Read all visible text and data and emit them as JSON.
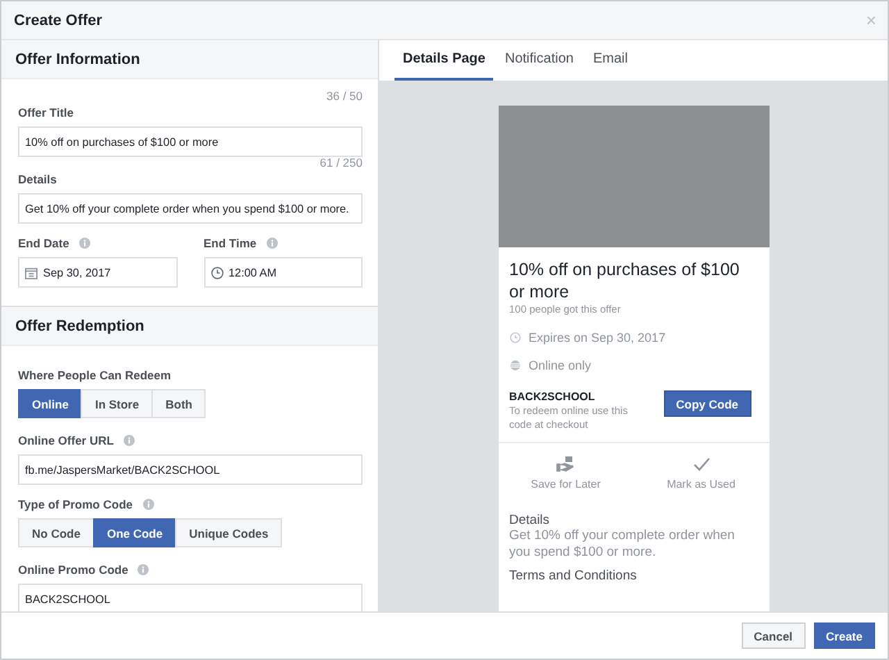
{
  "window": {
    "title": "Create Offer",
    "close": "×"
  },
  "offer_information": {
    "heading": "Offer Information",
    "offer_title": {
      "label": "Offer Title",
      "counter": "36 / 50",
      "value": "10% off on purchases of $100 or more"
    },
    "details": {
      "label": "Details",
      "counter": "61 / 250",
      "value": "Get 10% off your complete order when you spend $100 or more."
    },
    "end_date": {
      "label": "End Date",
      "value": "Sep 30, 2017"
    },
    "end_time": {
      "label": "End Time",
      "value": "12:00 AM"
    }
  },
  "offer_redemption": {
    "heading": "Offer Redemption",
    "where_redeem": {
      "label": "Where People Can Redeem",
      "options": [
        {
          "label": "Online",
          "selected": true
        },
        {
          "label": "In Store",
          "selected": false
        },
        {
          "label": "Both",
          "selected": false
        }
      ]
    },
    "online_offer_url": {
      "label": "Online Offer URL",
      "value": "fb.me/JaspersMarket/BACK2SCHOOL"
    },
    "promo_type": {
      "label": "Type of Promo Code",
      "options": [
        {
          "label": "No Code",
          "selected": false
        },
        {
          "label": "One Code",
          "selected": true
        },
        {
          "label": "Unique Codes",
          "selected": false
        }
      ]
    },
    "online_promo_code": {
      "label": "Online Promo Code",
      "value": "BACK2SCHOOL"
    }
  },
  "preview": {
    "tabs": [
      {
        "label": "Details Page",
        "selected": true
      },
      {
        "label": "Notification",
        "selected": false
      },
      {
        "label": "Email",
        "selected": false
      }
    ],
    "card": {
      "title": "10% off on purchases of $100 or more",
      "claimed": "100 people got this offer",
      "expires": "Expires on Sep 30, 2017",
      "availability": "Online only",
      "code": "BACK2SCHOOL",
      "code_hint": "To redeem online use this code at checkout",
      "copy_button": "Copy Code",
      "actions": [
        {
          "label": "Save for Later",
          "kind": "save"
        },
        {
          "label": "Mark as Used",
          "kind": "check"
        }
      ],
      "details_heading": "Details",
      "details_text": "Get 10% off your complete order when you spend $100 or more.",
      "terms_heading": "Terms and Conditions"
    }
  },
  "footer": {
    "buttons": [
      {
        "label": "Cancel",
        "kind": "secondary"
      },
      {
        "label": "Create",
        "kind": "primary"
      }
    ]
  }
}
